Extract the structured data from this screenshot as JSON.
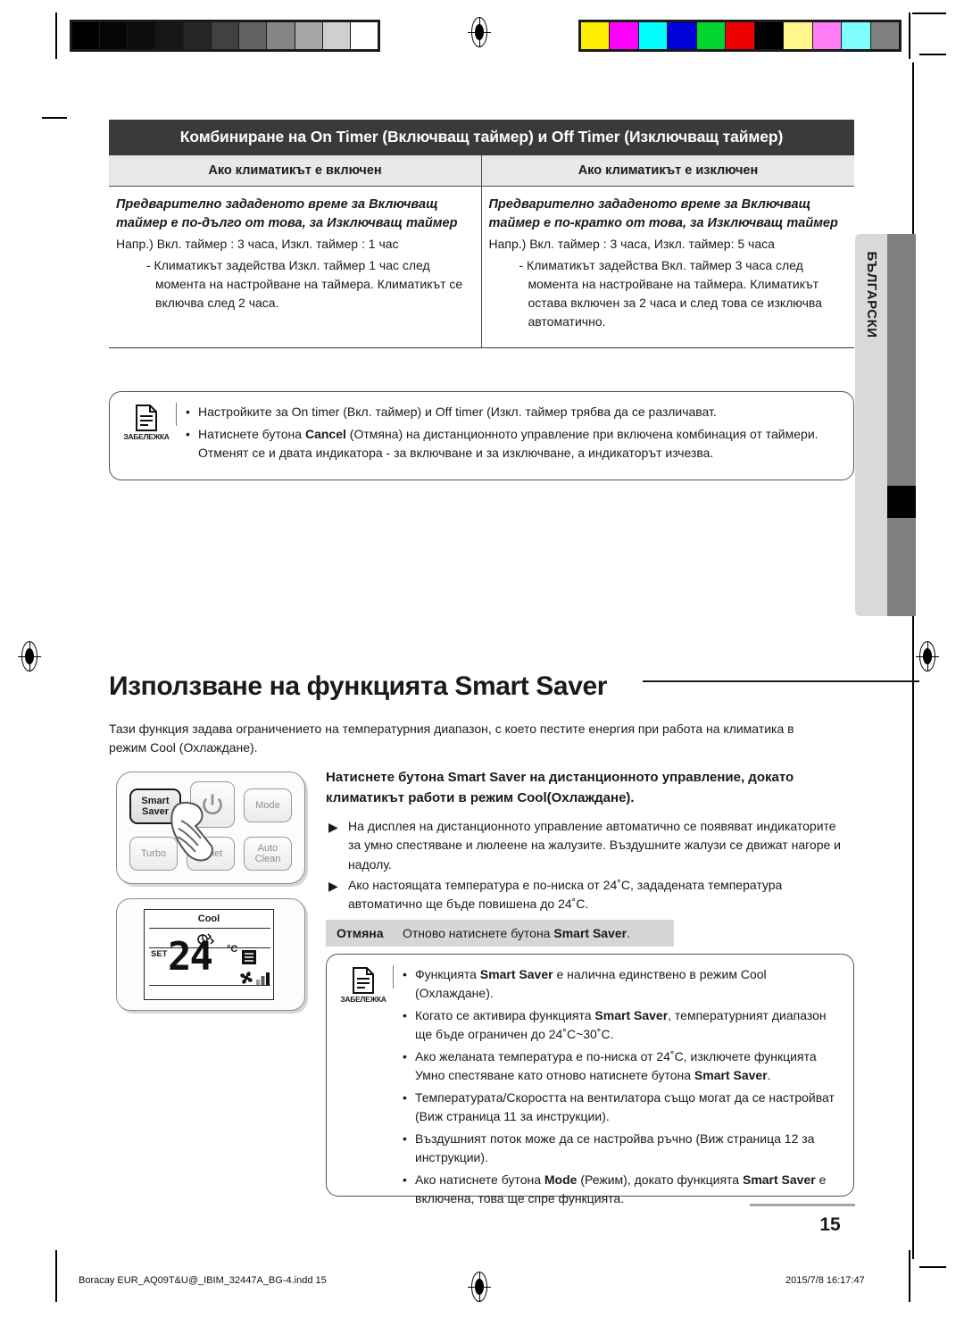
{
  "print_marks": {
    "gray_ramp": [
      "#000000",
      "#050505",
      "#0c0c0c",
      "#161616",
      "#262626",
      "#414141",
      "#636363",
      "#858585",
      "#a6a6a6",
      "#cfcfcf",
      "#ffffff"
    ],
    "color_ramp": [
      "#ffed00",
      "#ff00ff",
      "#00ffff",
      "#0000d8",
      "#00d62e",
      "#ee0000",
      "#000000",
      "#fff municipal",
      "#ff7df4",
      "#7dfdfd",
      "#808080"
    ],
    "color_ramp_fixed": [
      "#ffed00",
      "#ff00ff",
      "#00ffff",
      "#0000d8",
      "#00d62e",
      "#ee0000",
      "#000000",
      "#fff78a",
      "#ff7df4",
      "#7dfdfd",
      "#808080"
    ]
  },
  "side_tab": {
    "language": "БЪЛГАРСКИ"
  },
  "timer_table": {
    "title": "Комбиниране на On Timer (Включващ таймер) и Off Timer (Изключващ таймер)",
    "headers": [
      "Ако климатикът е включен",
      "Ако климатикът е изключен"
    ],
    "columns": [
      {
        "emphasis": "Предварително зададеното време за Включващ таймер е по-дълго от това, за Изключващ таймер",
        "example": "Напр.) Вкл. таймер : 3 часа, Изкл. таймер : 1 час",
        "detail": "- Климатикът задейства Изкл. таймер 1 час след момента на настройване на таймера. Климатикът се включва след 2 часа."
      },
      {
        "emphasis": "Предварително зададеното време за Включващ таймер е по-кратко от това, за Изключващ таймер",
        "example": "Напр.) Вкл. таймер : 3 часа, Изкл. таймер: 5 часа",
        "detail": "- Климатикът задейства Вкл. таймер 3 часа след момента на настройване на таймера. Климатикът остава включен за 2 часа и след това се изключва автоматично."
      }
    ]
  },
  "note_top": {
    "caption": "ЗАБЕЛЕЖКА",
    "items": [
      "Настройките за On timer (Вкл. таймер) и Off timer (Изкл. таймер трябва да се различават.",
      "Натиснете бутона Cancel (Отмяна) на дистанционното управление при включена комбинация от таймери. Отменят се и двата индикатора - за включване и за изключване, а индикаторът изчезва."
    ]
  },
  "section": {
    "heading": "Използване на функцията Smart Saver",
    "intro": "Тази функция задава ограничението на температурния диапазон, с което пестите енергия при работа на климатика в режим Cool (Охлаждане)."
  },
  "remote": {
    "buttons": [
      {
        "name": "Smart Saver",
        "line1": "Smart",
        "line2": "Saver",
        "active": true
      },
      {
        "name": "Power",
        "line1": "",
        "line2": "",
        "active": false
      },
      {
        "name": "Mode",
        "line1": "Mode",
        "line2": "",
        "active": false
      },
      {
        "name": "Turbo",
        "line1": "Turbo",
        "line2": "",
        "active": false
      },
      {
        "name": "Quiet",
        "line1": "Quiet",
        "line2": "",
        "active": false
      },
      {
        "name": "Auto Clean",
        "line1": "Auto",
        "line2": "Clean",
        "active": false
      }
    ]
  },
  "lcd": {
    "mode": "Cool",
    "set_label": "SET",
    "temperature": "24",
    "unit": "°C"
  },
  "instructions": {
    "lead": "Натиснете бутона Smart Saver на дистанционното управление, докато климатикът работи в режим Cool(Охлаждане).",
    "bullets": [
      "На дисплея на дистанционното управление автоматично се появяват индикаторите за умно спестяване и люлеене на жалузите. Въздушните жалузи се движат нагоре и надолу.",
      "Ако настоящата температура е по-ниска от 24˚C, зададената температура автоматично ще бъде повишена до 24˚C."
    ],
    "cancel_label": "Отмяна",
    "cancel_text": "Отново натиснете бутона Smart Saver."
  },
  "note_bottom": {
    "caption": "ЗАБЕЛЕЖКА",
    "items": [
      "Функцията Smart Saver е налична единствено в режим Cool (Охлаждане).",
      "Когато се активира функцията Smart Saver, температурният диапазон ще бъде ограничен до 24˚C~30˚C.",
      "Ако желаната температура е по-ниска от 24˚C, изключете функцията Умно спестяване като отново натиснете бутона Smart Saver.",
      "Температурата/Скоростта на вентилатора също могат да се настройват (Виж страница 11 за инструкции).",
      "Въздушният поток може да се настройва ръчно (Виж страница 12 за инструкции).",
      "Ако натиснете бутона Mode (Режим), докато функцията Smart Saver е включена, това ще спре функцията."
    ]
  },
  "footer": {
    "page_number": "15",
    "file_name": "Boracay EUR_AQ09T&U@_IBIM_32447A_BG-4.indd   15",
    "timestamp": "2015/7/8   16:17:47"
  }
}
